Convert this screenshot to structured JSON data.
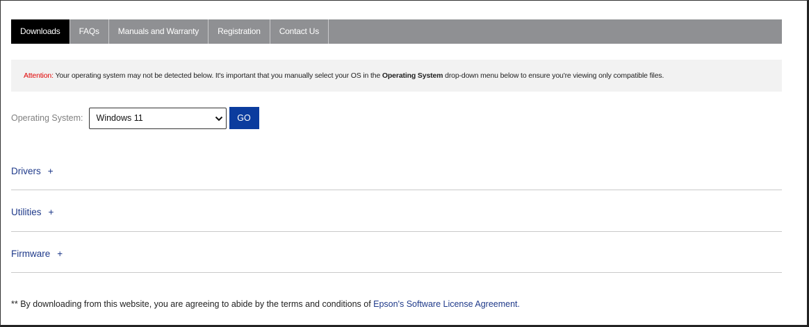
{
  "tabs": [
    {
      "label": "Downloads",
      "active": true
    },
    {
      "label": "FAQs"
    },
    {
      "label": "Manuals and Warranty"
    },
    {
      "label": "Registration"
    },
    {
      "label": "Contact Us"
    }
  ],
  "alert": {
    "attention": "Attention:",
    "text1": " Your operating system may not be detected below. It's important that you manually select your OS in the ",
    "bold": "Operating System",
    "text2": " drop-down menu below to ensure you're viewing only compatible files."
  },
  "os": {
    "label": "Operating System:",
    "selected": "Windows 11",
    "go_label": "GO"
  },
  "sections": {
    "drivers": "Drivers",
    "utilities": "Utilities",
    "firmware": "Firmware",
    "plus": "+"
  },
  "footer": {
    "text": "** By downloading from this website, you are agreeing to abide by the terms and conditions of ",
    "link": "Epson's Software License Agreement."
  },
  "colors": {
    "tabbar": "#8f9093",
    "tab_active": "#000000",
    "alert_bg": "#f2f2f2",
    "attention": "#e00000",
    "go_button": "#0b3c9e",
    "link": "#1f3a8a"
  }
}
